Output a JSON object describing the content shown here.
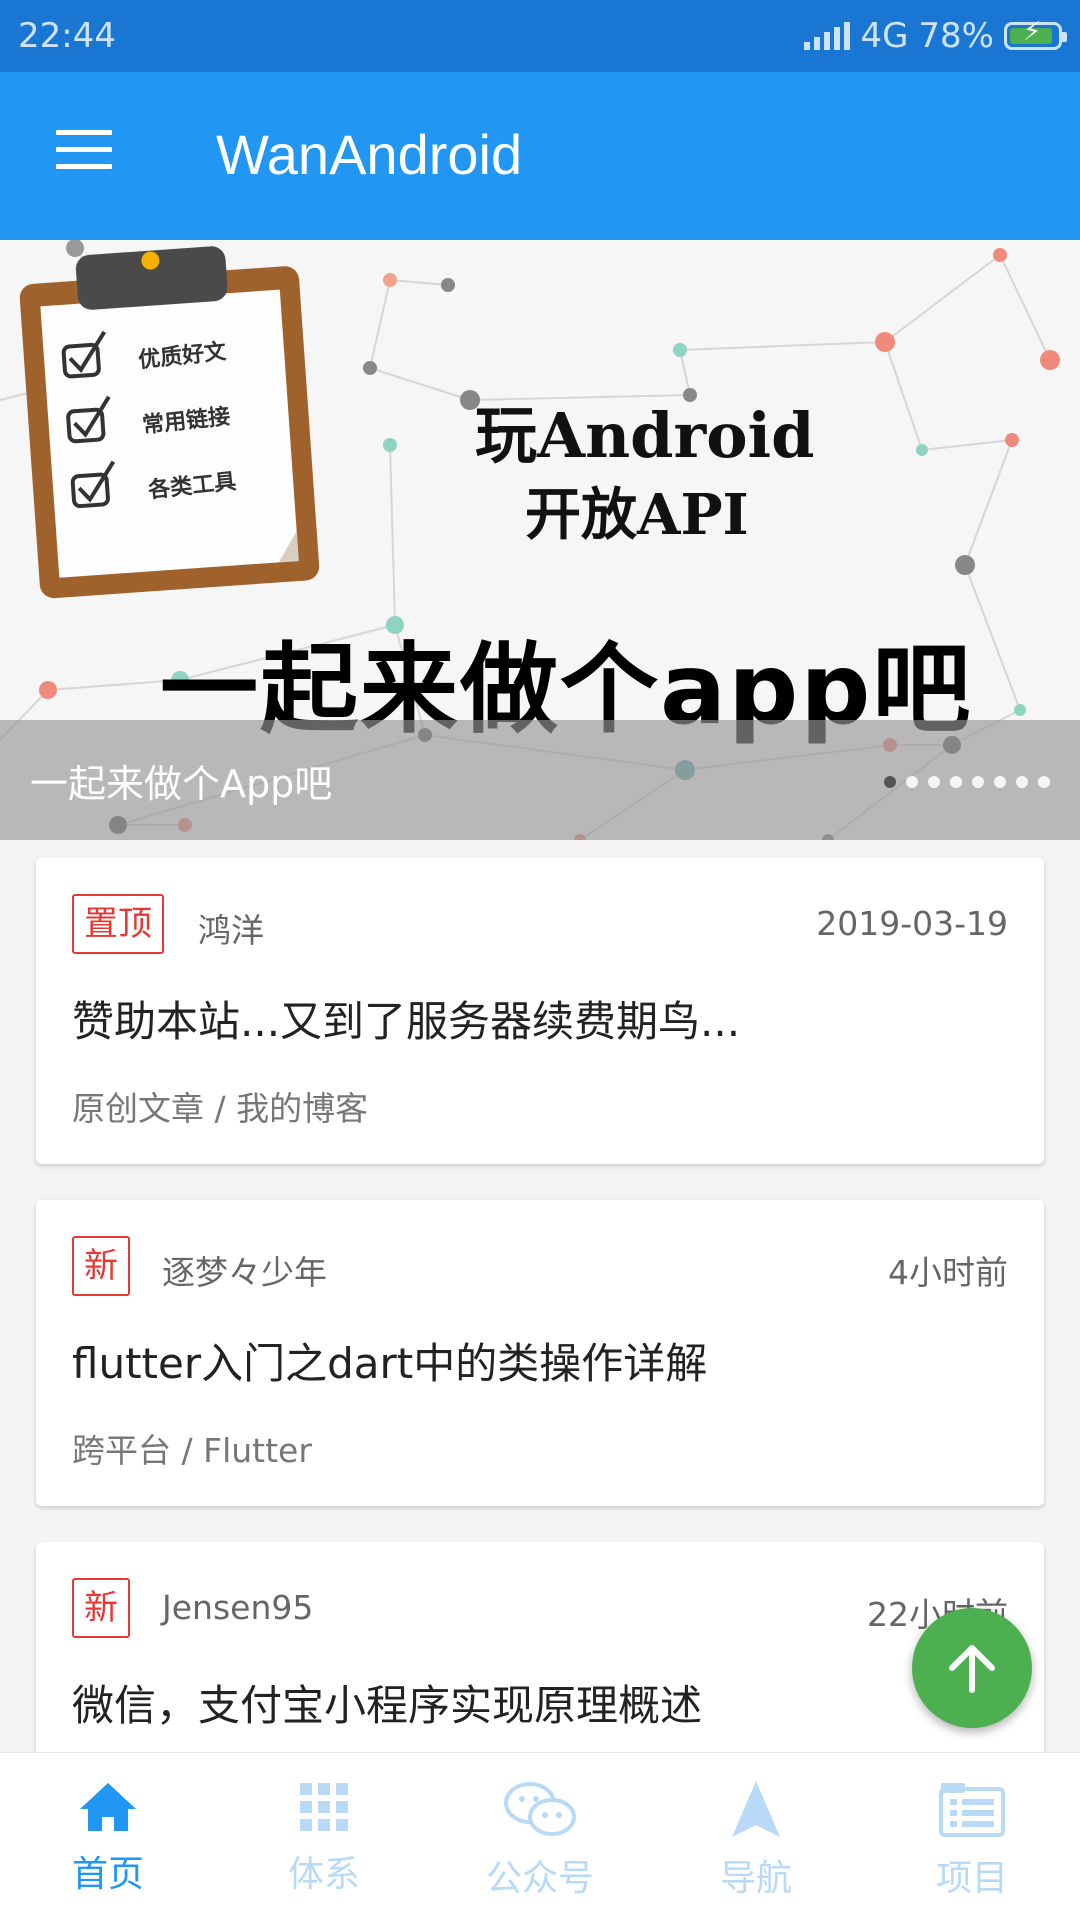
{
  "status_bar": {
    "time": "22:44",
    "network": "4G",
    "battery": "78%"
  },
  "toolbar": {
    "title": "WanAndroid"
  },
  "banner": {
    "headline_line1": "玩Android",
    "headline_line2": "开放API",
    "slogan": "一起来做个app吧",
    "clipboard_items": [
      "优质好文",
      "常用链接",
      "各类工具"
    ],
    "caption": "一起来做个App吧",
    "active_dot": 0,
    "dot_count": 8
  },
  "articles": [
    {
      "tag": "置顶",
      "author": "鸿洋",
      "date": "2019-03-19",
      "title": "赞助本站...又到了服务器续费期鸟...",
      "chapter": "原创文章 / 我的博客"
    },
    {
      "tag": "新",
      "author": "逐梦々少年",
      "date": "4小时前",
      "title": "flutter入门之dart中的类操作详解",
      "chapter": "跨平台 / Flutter"
    },
    {
      "tag": "新",
      "author": "Jensen95",
      "date": "22小时前",
      "title": "微信，支付宝小程序实现原理概述",
      "chapter": ""
    }
  ],
  "bottom_nav": [
    {
      "label": "首页",
      "icon": "home-icon",
      "active": true
    },
    {
      "label": "体系",
      "icon": "grid-icon",
      "active": false
    },
    {
      "label": "公众号",
      "icon": "wechat-icon",
      "active": false
    },
    {
      "label": "导航",
      "icon": "navigation-arrow-icon",
      "active": false
    },
    {
      "label": "项目",
      "icon": "list-icon",
      "active": false
    }
  ],
  "colors": {
    "primary": "#2196f3",
    "status_bar": "#1976d2",
    "tag": "#e53935",
    "fab": "#4caf50"
  }
}
